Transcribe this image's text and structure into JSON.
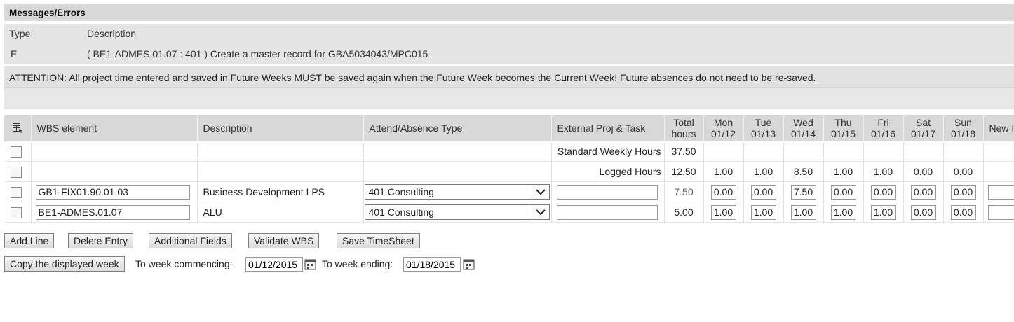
{
  "messages": {
    "title": "Messages/Errors",
    "col_type": "Type",
    "col_description": "Description",
    "rows": [
      {
        "type": "E",
        "description": "( BE1-ADMES.01.07 : 401 ) Create a master record for GBA5034043/MPC015"
      }
    ]
  },
  "attention": "ATTENTION: All project time entered and saved in Future Weeks MUST be saved again when the Future Week becomes the Current Week! Future absences do not need to be re-saved.",
  "grid": {
    "headers": {
      "wbs": "WBS element",
      "description": "Description",
      "attend": "Attend/Absence Type",
      "external": "External Proj & Task",
      "total_1": "Total",
      "total_2": "hours",
      "new": "New I"
    },
    "days": [
      {
        "name": "Mon",
        "date": "01/12"
      },
      {
        "name": "Tue",
        "date": "01/13"
      },
      {
        "name": "Wed",
        "date": "01/14"
      },
      {
        "name": "Thu",
        "date": "01/15"
      },
      {
        "name": "Fri",
        "date": "01/16"
      },
      {
        "name": "Sat",
        "date": "01/17"
      },
      {
        "name": "Sun",
        "date": "01/18"
      }
    ],
    "standard": {
      "label": "Standard Weekly Hours",
      "total": "37.50"
    },
    "logged": {
      "label": "Logged Hours",
      "total": "12.50",
      "days": [
        "1.00",
        "1.00",
        "8.50",
        "1.00",
        "1.00",
        "0.00",
        "0.00"
      ]
    },
    "rows": [
      {
        "wbs": "GB1-FIX01.90.01.03",
        "description": "Business Development LPS",
        "attend": "401 Consulting",
        "external": "",
        "total": "7.50",
        "days": [
          "0.00",
          "0.00",
          "7.50",
          "0.00",
          "0.00",
          "0.00",
          "0.00"
        ]
      },
      {
        "wbs": "BE1-ADMES.01.07",
        "description": "ALU",
        "attend": "401 Consulting",
        "external": "",
        "total": "5.00",
        "days": [
          "1.00",
          "1.00",
          "1.00",
          "1.00",
          "1.00",
          "0.00",
          "0.00"
        ]
      }
    ]
  },
  "buttons": {
    "add_line": "Add Line",
    "delete_entry": "Delete Entry",
    "additional_fields": "Additional Fields",
    "validate_wbs": "Validate WBS",
    "save_timesheet": "Save TimeSheet",
    "copy_week": "Copy the displayed week"
  },
  "copy": {
    "commencing_label": "To week commencing:",
    "commencing_value": "01/12/2015",
    "ending_label": "To week ending:",
    "ending_value": "01/18/2015"
  },
  "icons": {
    "table_settings": "table-settings-icon",
    "calendar": "calendar-icon",
    "dropdown": "chevron-down-icon"
  }
}
